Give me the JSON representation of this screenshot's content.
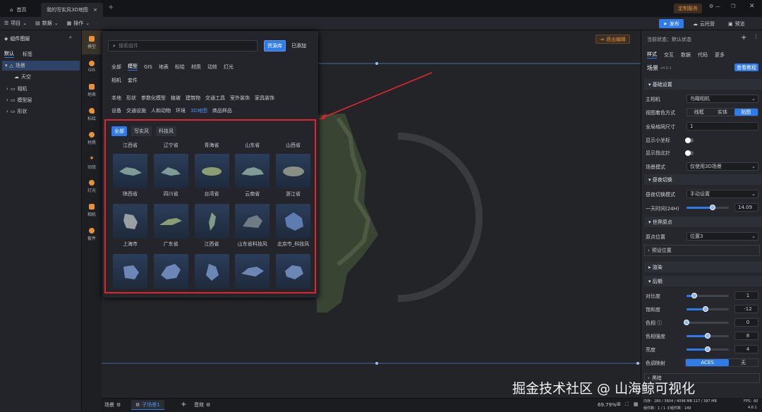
{
  "titlebar": {
    "home": "首页",
    "doc_tab": "我的写实风3D地图",
    "add_tab": "+",
    "badge": "定制服务",
    "window_icons": [
      "bell",
      "gear",
      "minimize",
      "restore",
      "close"
    ]
  },
  "menubar": {
    "items": [
      "项目",
      "数据",
      "操作"
    ],
    "publish": "发布",
    "cloud": "云托管",
    "preview": "预览"
  },
  "left": {
    "title": "组件图层",
    "tabs": [
      "默认",
      "标签"
    ],
    "tree": [
      {
        "label": "场景",
        "level": 0
      },
      {
        "label": "天空",
        "level": 1
      },
      {
        "label": "相机",
        "level": 0
      },
      {
        "label": "模型层",
        "level": 0
      },
      {
        "label": "形状",
        "level": 0
      }
    ]
  },
  "iconbar": [
    "模型",
    "GIS",
    "地表",
    "标绘",
    "材质",
    "动效",
    "灯光",
    "相机",
    "套件"
  ],
  "popup": {
    "search_placeholder": "搜索组件",
    "btn_lib": "资源库",
    "btn_added": "已添加",
    "cats1": [
      "全部",
      "模型",
      "GIS",
      "地表",
      "标绘",
      "材质",
      "动效",
      "灯光"
    ],
    "cats2": [
      "相机",
      "套件"
    ],
    "tags1": [
      "本地",
      "形状",
      "参数化模型",
      "植被",
      "建筑物",
      "交通工具",
      "室外装饰",
      "家具装饰"
    ],
    "tags2": [
      "设备",
      "交通设施",
      "人和动物",
      "环境",
      "3D地图",
      "商品样品"
    ],
    "styles": [
      "全部",
      "写实风",
      "科技风"
    ],
    "top_labels": [
      "江西省",
      "辽宁省",
      "青海省",
      "山东省",
      "山西省"
    ],
    "grid": [
      [
        "陕西省",
        "四川省",
        "台湾省",
        "云南省",
        "浙江省"
      ],
      [
        "上海市",
        "广东省",
        "江西省",
        "山东省科技风",
        "北京市_科技风"
      ]
    ]
  },
  "canvas": {
    "exit": "退出编辑"
  },
  "right": {
    "status": "当前状态：默认状态",
    "tabs": [
      "样式",
      "交互",
      "数据",
      "代码",
      "更多"
    ],
    "scene_title": "场景",
    "version": "v4.6.1",
    "tutorial": "查看教程",
    "basic": "基础设置",
    "camera_label": "主相机",
    "camera_val": "鸟瞰相机",
    "view_label": "视图着色方式",
    "view_opts": [
      "线框",
      "实体",
      "贴图"
    ],
    "gridsize_label": "全局格网尺寸",
    "gridsize_val": "1",
    "coord_label": "显示小坐标",
    "compass_label": "显示指北针",
    "mode_label": "场景模式",
    "mode_val": "仅使用3D场景",
    "daynight": "昼夜切换",
    "dn_mode_label": "昼夜切换模式",
    "dn_mode_val": "手动设置",
    "time_label": "一天时间(24H)",
    "time_val": "14.09",
    "time_frac": 0.62,
    "world": "世界原点",
    "origin_label": "原点位置",
    "origin_val": "位置3",
    "preset": "预设位置",
    "render": "渲染",
    "post": "后期",
    "post_items": [
      {
        "label": "对比度",
        "val": "1",
        "frac": 0.18
      },
      {
        "label": "饱和度",
        "val": "-12",
        "frac": 0.45
      },
      {
        "label": "色相 ⓘ",
        "val": "0",
        "frac": 0.0
      },
      {
        "label": "色相强度",
        "val": "8",
        "frac": 0.5
      },
      {
        "label": "亮度",
        "val": "4",
        "frac": 0.5
      }
    ],
    "tone_label": "色调映射",
    "tone_opts": [
      "ACES",
      "无"
    ],
    "more": "黑暗"
  },
  "bottom": {
    "scene_tab": "场景",
    "scene2": "子场景1",
    "add": "+",
    "audio": "音效",
    "zoom": "69.79%"
  },
  "status": {
    "mem": "内存：280 / 3804 / 4096 MB 117 / 397 MB",
    "fps": "FPS：60",
    "count": "组件数：1 / 1 子组件数：149",
    "ver": "4.6.1"
  },
  "watermark": "掘金技术社区 @ 山海鲸可视化",
  "colors": {
    "accent": "#2f7bea",
    "orange": "#e8913a",
    "highlight": "#e0262c"
  }
}
